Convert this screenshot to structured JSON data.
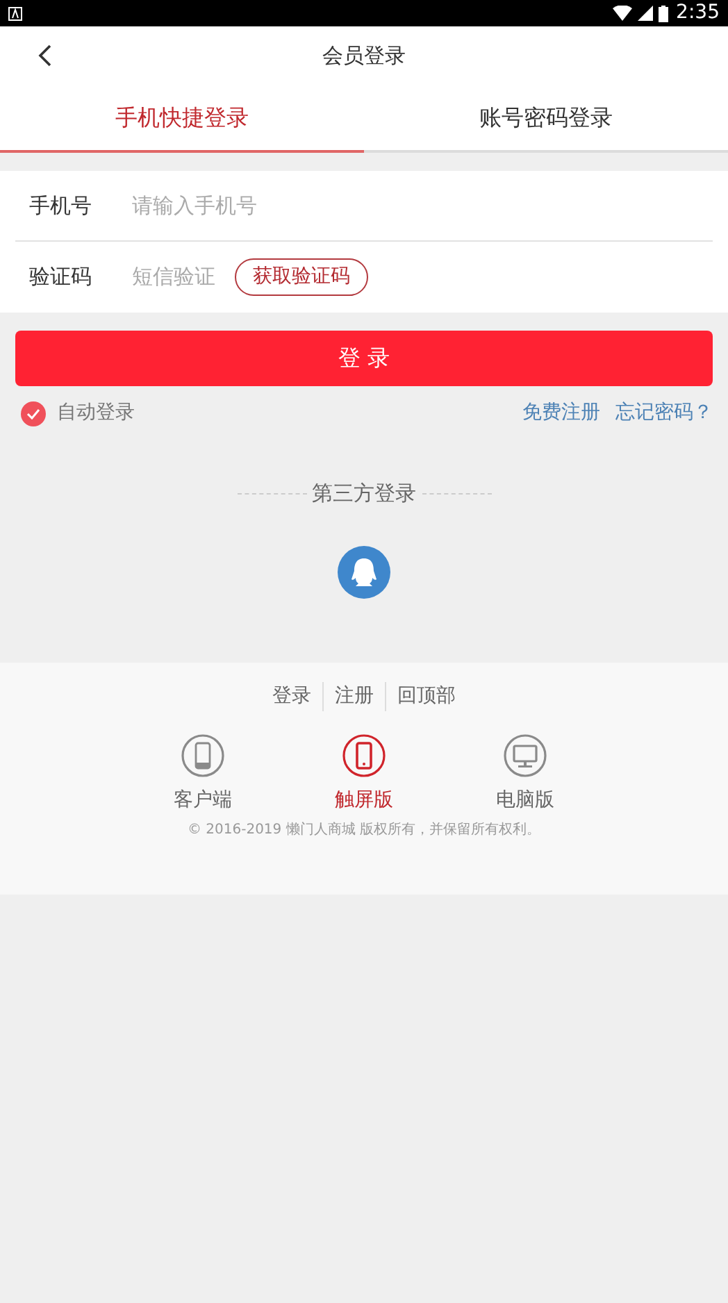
{
  "status_bar": {
    "time": "2:35"
  },
  "header": {
    "title": "会员登录"
  },
  "tabs": [
    {
      "label": "手机快捷登录",
      "selected": true
    },
    {
      "label": "账号密码登录",
      "selected": false
    }
  ],
  "form": {
    "rows": [
      {
        "label": "手机号",
        "placeholder": "请输入手机号"
      },
      {
        "label": "验证码",
        "placeholder": "短信验证",
        "button": "获取验证码"
      }
    ]
  },
  "login_button": "登 录",
  "auto_login": {
    "label": "自动登录",
    "checked": true
  },
  "links": [
    "免费注册",
    "忘记密码？"
  ],
  "third_party": {
    "title": "第三方登录"
  },
  "footer": {
    "links": [
      "登录",
      "注册",
      "回顶部"
    ],
    "versions": [
      {
        "kind": "app",
        "label": "客户端",
        "selected": false
      },
      {
        "kind": "touch",
        "label": "触屏版",
        "selected": true
      },
      {
        "kind": "pc",
        "label": "电脑版",
        "selected": false
      }
    ],
    "copyright": "© 2016-2019 懒门人商城 版权所有，并保留所有权利。"
  }
}
